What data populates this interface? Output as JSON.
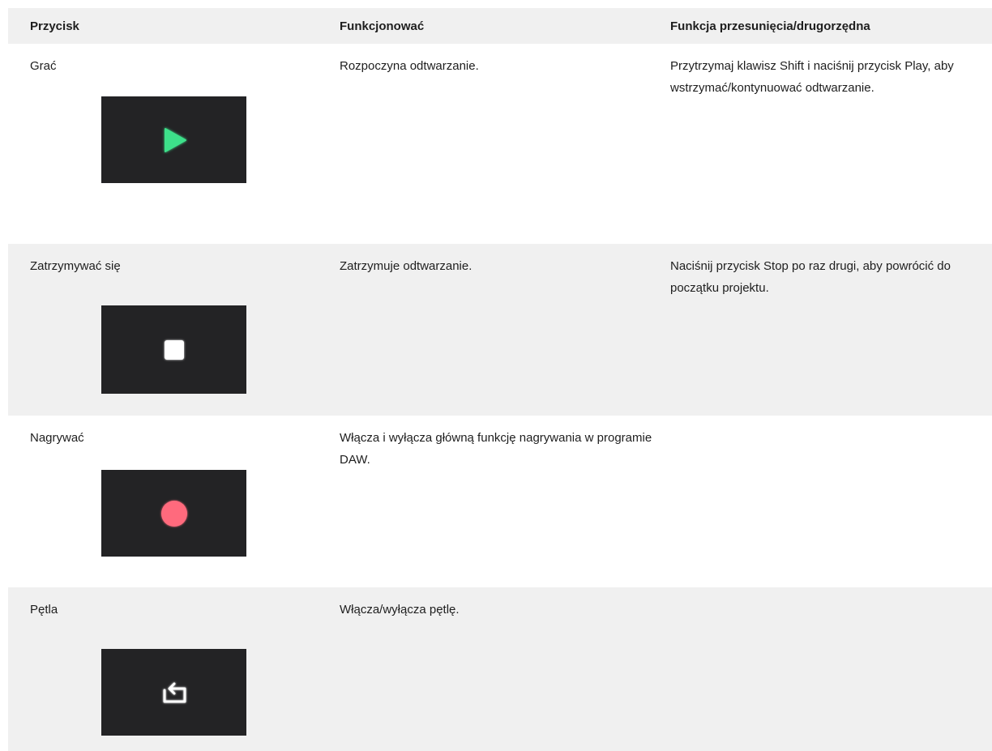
{
  "table": {
    "headers": {
      "button": "Przycisk",
      "function": "Funkcjonować",
      "shift": "Funkcja przesunięcia/drugorzędna"
    },
    "rows": [
      {
        "button": "Grać",
        "icon": "play-icon",
        "icon_color": "#3ee08a",
        "function": "Rozpoczyna odtwarzanie.",
        "shift": "Przytrzymaj klawisz Shift i naciśnij przycisk Play, aby wstrzymać/kontynuować odtwarzanie."
      },
      {
        "button": "Zatrzymywać się",
        "icon": "stop-icon",
        "icon_color": "#ffffff",
        "function": "Zatrzymuje odtwarzanie.",
        "shift": "Naciśnij przycisk Stop po raz drugi, aby powrócić do początku projektu."
      },
      {
        "button": "Nagrywać",
        "icon": "record-icon",
        "icon_color": "#ff6b7d",
        "function": "Włącza i wyłącza główną funkcję nagrywania w programie DAW.",
        "shift": ""
      },
      {
        "button": "Pętla",
        "icon": "loop-icon",
        "icon_color": "#ffffff",
        "function": "Włącza/wyłącza pętlę.",
        "shift": ""
      }
    ]
  }
}
